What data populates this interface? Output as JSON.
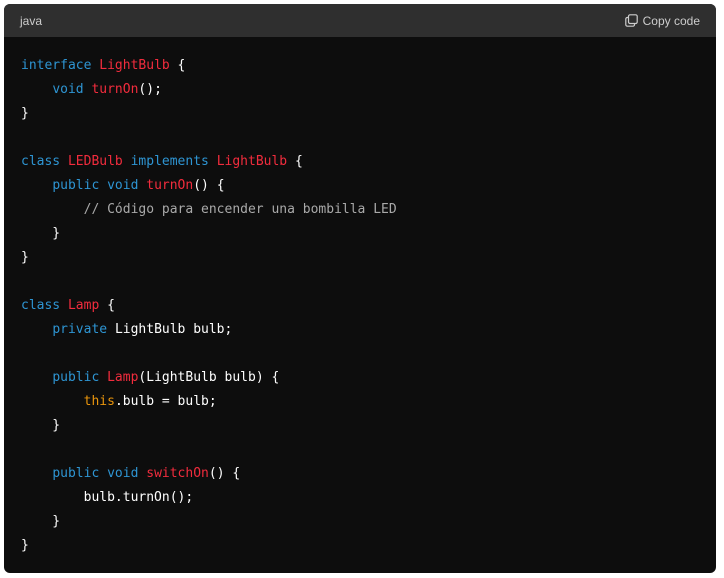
{
  "header": {
    "language": "java",
    "copy_label": "Copy code"
  },
  "code": {
    "lines": [
      [
        {
          "t": "interface ",
          "c": "kw"
        },
        {
          "t": "LightBulb",
          "c": "ty"
        },
        {
          "t": " {",
          "c": "pl"
        }
      ],
      [
        {
          "t": "    ",
          "c": "pl"
        },
        {
          "t": "void ",
          "c": "kw"
        },
        {
          "t": "turnOn",
          "c": "ty"
        },
        {
          "t": "();",
          "c": "pl"
        }
      ],
      [
        {
          "t": "}",
          "c": "pl"
        }
      ],
      [],
      [
        {
          "t": "class ",
          "c": "kw"
        },
        {
          "t": "LEDBulb ",
          "c": "ty"
        },
        {
          "t": "implements ",
          "c": "kw"
        },
        {
          "t": "LightBulb",
          "c": "ty"
        },
        {
          "t": " {",
          "c": "pl"
        }
      ],
      [
        {
          "t": "    ",
          "c": "pl"
        },
        {
          "t": "public ",
          "c": "kw"
        },
        {
          "t": "void ",
          "c": "kw"
        },
        {
          "t": "turnOn",
          "c": "ty"
        },
        {
          "t": "() {",
          "c": "pl"
        }
      ],
      [
        {
          "t": "        ",
          "c": "pl"
        },
        {
          "t": "// Código para encender una bombilla LED",
          "c": "cm"
        }
      ],
      [
        {
          "t": "    }",
          "c": "pl"
        }
      ],
      [
        {
          "t": "}",
          "c": "pl"
        }
      ],
      [],
      [
        {
          "t": "class ",
          "c": "kw"
        },
        {
          "t": "Lamp",
          "c": "ty"
        },
        {
          "t": " {",
          "c": "pl"
        }
      ],
      [
        {
          "t": "    ",
          "c": "pl"
        },
        {
          "t": "private ",
          "c": "kw"
        },
        {
          "t": "LightBulb bulb;",
          "c": "pl"
        }
      ],
      [],
      [
        {
          "t": "    ",
          "c": "pl"
        },
        {
          "t": "public ",
          "c": "kw"
        },
        {
          "t": "Lamp",
          "c": "ty"
        },
        {
          "t": "(LightBulb bulb) {",
          "c": "pl"
        }
      ],
      [
        {
          "t": "        ",
          "c": "pl"
        },
        {
          "t": "this",
          "c": "kwo"
        },
        {
          "t": ".bulb = bulb;",
          "c": "pl"
        }
      ],
      [
        {
          "t": "    }",
          "c": "pl"
        }
      ],
      [],
      [
        {
          "t": "    ",
          "c": "pl"
        },
        {
          "t": "public ",
          "c": "kw"
        },
        {
          "t": "void ",
          "c": "kw"
        },
        {
          "t": "switchOn",
          "c": "ty"
        },
        {
          "t": "() {",
          "c": "pl"
        }
      ],
      [
        {
          "t": "        bulb.turnOn();",
          "c": "pl"
        }
      ],
      [
        {
          "t": "    }",
          "c": "pl"
        }
      ],
      [
        {
          "t": "}",
          "c": "pl"
        }
      ]
    ]
  },
  "colors": {
    "background": "#0d0d0d",
    "header": "#2f2f2f",
    "keyword": "#2e95d3",
    "type": "#f22c3d",
    "comment": "#a9a9a9",
    "this_keyword": "#e9950c"
  },
  "icons": {
    "copy": "copy-icon"
  }
}
